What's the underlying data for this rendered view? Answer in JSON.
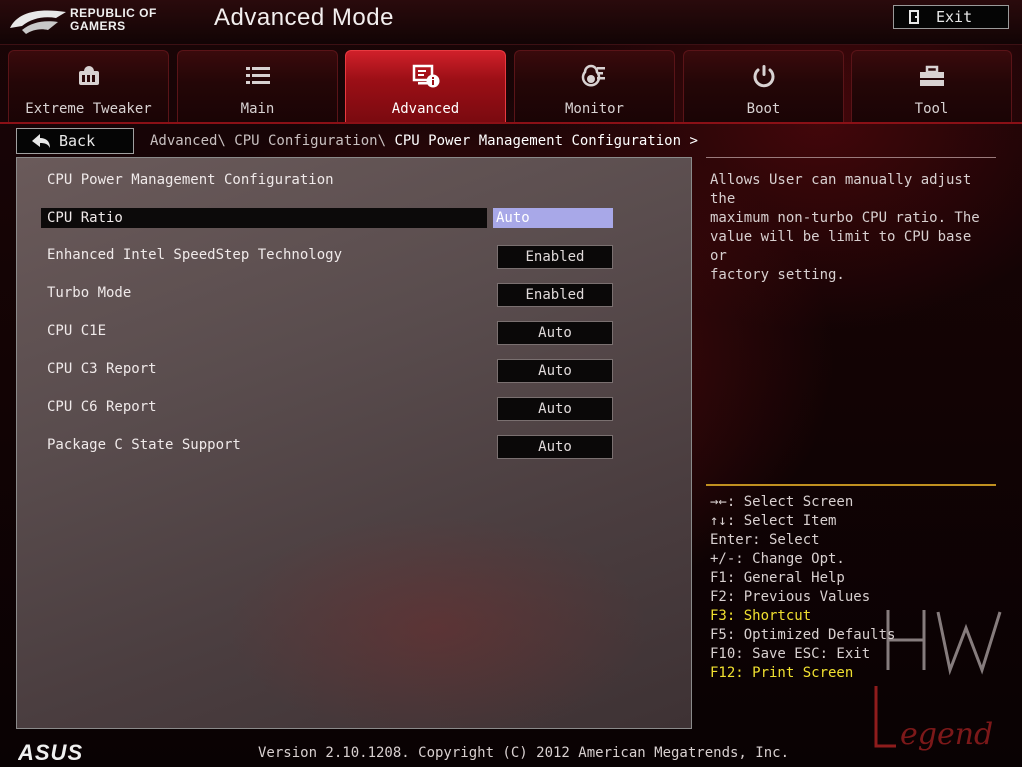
{
  "header": {
    "brand_line1": "REPUBLIC OF",
    "brand_line2": "GAMERS",
    "mode_title": "Advanced Mode",
    "exit_label": "Exit"
  },
  "tabs": [
    {
      "label": "Extreme Tweaker",
      "icon": "tweaker-icon",
      "active": false
    },
    {
      "label": "Main",
      "icon": "list-icon",
      "active": false
    },
    {
      "label": "Advanced",
      "icon": "advanced-icon",
      "active": true
    },
    {
      "label": "Monitor",
      "icon": "thermometer-icon",
      "active": false
    },
    {
      "label": "Boot",
      "icon": "power-icon",
      "active": false
    },
    {
      "label": "Tool",
      "icon": "toolbox-icon",
      "active": false
    }
  ],
  "breadcrumb": {
    "back_label": "Back",
    "path": "Advanced\\ CPU Configuration\\ ",
    "current": "CPU Power Management Configuration >"
  },
  "main": {
    "section_title": "CPU Power Management Configuration",
    "settings": [
      {
        "label": "CPU Ratio",
        "value": "Auto",
        "selected": true
      },
      {
        "label": "Enhanced Intel SpeedStep Technology",
        "value": "Enabled"
      },
      {
        "label": "Turbo Mode",
        "value": "Enabled"
      },
      {
        "label": "CPU C1E",
        "value": "Auto"
      },
      {
        "label": "CPU C3 Report",
        "value": "Auto"
      },
      {
        "label": "CPU C6 Report",
        "value": "Auto"
      },
      {
        "label": "Package C State Support",
        "value": "Auto"
      }
    ]
  },
  "help": {
    "text": "Allows User can manually adjust the\nmaximum non-turbo CPU ratio. The\nvalue will be limit to CPU base or\nfactory setting."
  },
  "keys": [
    {
      "text": "→←: Select Screen"
    },
    {
      "text": "↑↓: Select Item"
    },
    {
      "text": "Enter: Select"
    },
    {
      "text": "+/-: Change Opt."
    },
    {
      "text": "F1: General Help"
    },
    {
      "text": "F2: Previous Values"
    },
    {
      "text": "F3: Shortcut",
      "highlight": true
    },
    {
      "text": "F5: Optimized Defaults"
    },
    {
      "text": "F10: Save  ESC: Exit"
    },
    {
      "text": "F12: Print Screen",
      "highlight": true
    }
  ],
  "footer": {
    "brand": "ASUS",
    "version": "Version 2.10.1208. Copyright (C) 2012 American Megatrends, Inc."
  },
  "watermark": {
    "text": "HW Legend"
  },
  "colors": {
    "accent_red": "#d0202a",
    "selected_value_bg": "#a8a8e8",
    "key_highlight": "#f0e030",
    "divider_gold": "#c09020"
  }
}
